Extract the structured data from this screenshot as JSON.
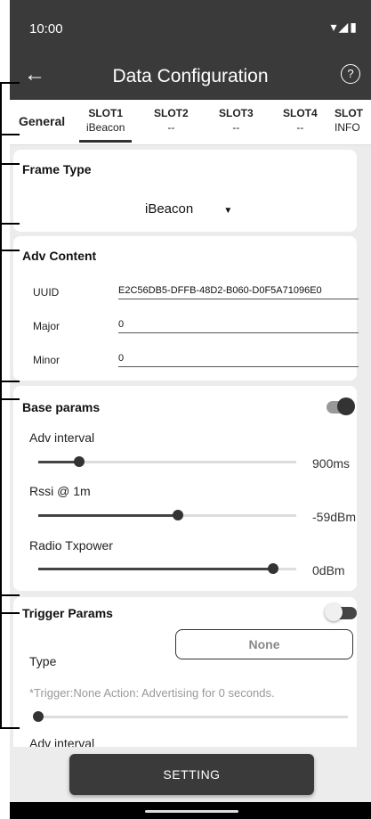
{
  "status": {
    "time": "10:00",
    "icons": "▾◢▮"
  },
  "appbar": {
    "back_icon": "←",
    "title": "Data Configuration",
    "help_icon": "?"
  },
  "tabs": [
    {
      "label": "General",
      "sub": ""
    },
    {
      "label": "SLOT1",
      "sub": "iBeacon"
    },
    {
      "label": "SLOT2",
      "sub": "--"
    },
    {
      "label": "SLOT3",
      "sub": "--"
    },
    {
      "label": "SLOT4",
      "sub": "--"
    },
    {
      "label": "SLOT",
      "sub": "INFO"
    }
  ],
  "frame_type": {
    "title": "Frame Type",
    "value": "iBeacon",
    "arrow": "▼"
  },
  "adv_content": {
    "title": "Adv Content",
    "fields": [
      {
        "label": "UUID",
        "value": "E2C56DB5-DFFB-48D2-B060-D0F5A71096E0"
      },
      {
        "label": "Major",
        "value": "0"
      },
      {
        "label": "Minor",
        "value": "0"
      }
    ]
  },
  "base_params": {
    "title": "Base params",
    "enabled": true,
    "sliders": [
      {
        "label": "Adv interval",
        "value": "900ms",
        "fraction": 0.16
      },
      {
        "label": "Rssi @ 1m",
        "value": "-59dBm",
        "fraction": 0.54
      },
      {
        "label": "Radio Txpower",
        "value": "0dBm",
        "fraction": 0.91
      }
    ]
  },
  "trigger_params": {
    "title": "Trigger Params",
    "enabled": false,
    "type_label": "Type",
    "type_value": "None",
    "hint": "*Trigger:None   Action: Advertising for 0 seconds.",
    "slider_fraction": 0.0,
    "adv_interval_label": "Adv interval"
  },
  "setting_button": "SETTING",
  "colors": {
    "bar": "#3a3a3a",
    "background": "#ececec"
  }
}
